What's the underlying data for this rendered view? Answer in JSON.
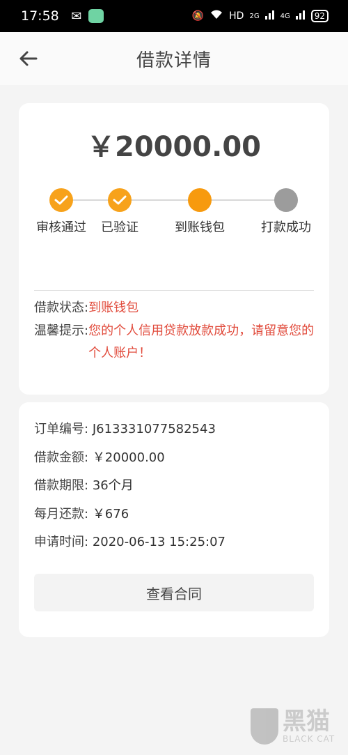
{
  "status_bar": {
    "time": "17:58",
    "network": "HD",
    "signal1": "2G",
    "signal2": "4G",
    "battery": "92"
  },
  "nav": {
    "title": "借款详情"
  },
  "loan": {
    "amount_display": "￥20000.00"
  },
  "steps": [
    {
      "label": "审核通过",
      "state": "done"
    },
    {
      "label": "已验证",
      "state": "done"
    },
    {
      "label": "到账钱包",
      "state": "current"
    },
    {
      "label": "打款成功",
      "state": "todo"
    }
  ],
  "status": {
    "status_label": "借款状态:",
    "status_value": "到账钱包",
    "tip_label": "温馨提示:",
    "tip_value": "您的个人信用贷款放款成功，请留意您的个人账户！"
  },
  "details": {
    "order_no_label": "订单编号:",
    "order_no": "J613331077582543",
    "amount_label": "借款金额:",
    "amount": "￥20000.00",
    "term_label": "借款期限:",
    "term": "36个月",
    "monthly_label": "每月还款:",
    "monthly": "￥676",
    "apply_time_label": "申请时间:",
    "apply_time": "2020-06-13 15:25:07"
  },
  "actions": {
    "view_contract": "查看合同"
  },
  "watermark": {
    "cn": "黑猫",
    "en": "BLACK CAT"
  },
  "colors": {
    "accent_orange": "#f7a21b",
    "pending_gray": "#9c9c9c",
    "status_red": "#e14b3c"
  }
}
